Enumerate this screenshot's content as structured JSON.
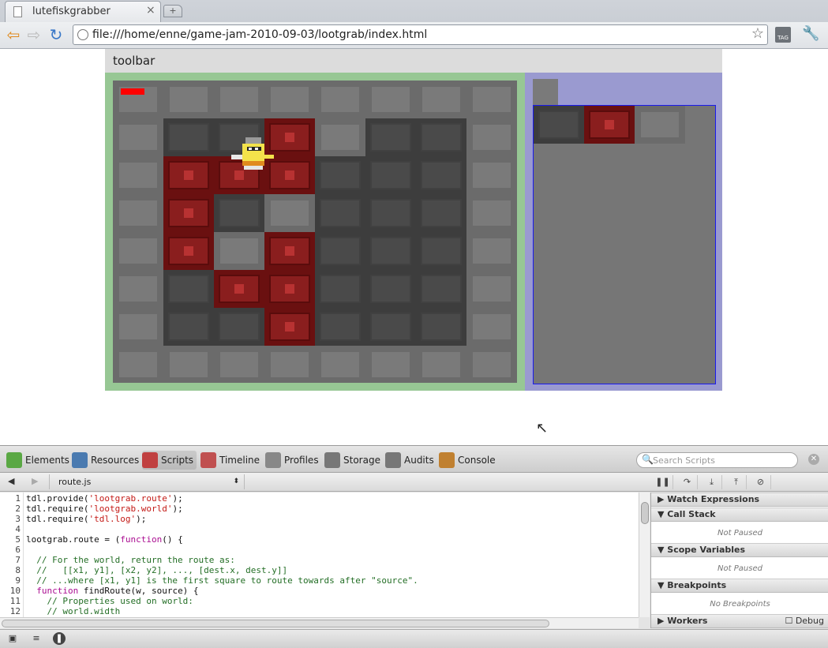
{
  "browser": {
    "tab_title": "lutefiskgrabber",
    "tab_close": "×",
    "new_tab": "+",
    "url": "file:///home/enne/game-jam-2010-09-03/lootgrab/index.html",
    "tag_label": "TAG"
  },
  "page": {
    "toolbar_label": "toolbar"
  },
  "devtools": {
    "tabs": [
      {
        "label": "Elements",
        "icon": "elements-icon",
        "color": "#5aa844"
      },
      {
        "label": "Resources",
        "icon": "resources-icon",
        "color": "#4a7ab0"
      },
      {
        "label": "Scripts",
        "icon": "scripts-icon",
        "color": "#c04040"
      },
      {
        "label": "Timeline",
        "icon": "timeline-icon",
        "color": "#c05050"
      },
      {
        "label": "Profiles",
        "icon": "profiles-icon",
        "color": "#888888"
      },
      {
        "label": "Storage",
        "icon": "storage-icon",
        "color": "#777777"
      },
      {
        "label": "Audits",
        "icon": "audits-icon",
        "color": "#777777"
      },
      {
        "label": "Console",
        "icon": "console-icon",
        "color": "#c08030"
      }
    ],
    "selected_tab": "Scripts",
    "search_placeholder": "Search Scripts",
    "file": "route.js",
    "code_lines": [
      {
        "n": "1",
        "html": "tdl.provide(<span class='str'>'lootgrab.route'</span>);"
      },
      {
        "n": "2",
        "html": "tdl.require(<span class='str'>'lootgrab.world'</span>);"
      },
      {
        "n": "3",
        "html": "tdl.require(<span class='str'>'tdl.log'</span>);"
      },
      {
        "n": "4",
        "html": ""
      },
      {
        "n": "5",
        "html": "lootgrab.route = (<span class='kw'>function</span>() {"
      },
      {
        "n": "6",
        "html": ""
      },
      {
        "n": "7",
        "html": "  <span class='cm'>// For the world, return the route as:</span>"
      },
      {
        "n": "8",
        "html": "  <span class='cm'>//   [[x1, y1], [x2, y2], ..., [dest.x, dest.y]]</span>"
      },
      {
        "n": "9",
        "html": "  <span class='cm'>// ...where [x1, y1] is the first square to route towards after \"source\".</span>"
      },
      {
        "n": "10",
        "html": "  <span class='kw'>function</span> findRoute(w, source) {"
      },
      {
        "n": "11",
        "html": "    <span class='cm'>// Properties used on world:</span>"
      },
      {
        "n": "12",
        "html": "    <span class='cm'>// world.width</span>"
      }
    ],
    "sidebar": {
      "watch": "Watch Expressions",
      "callstack": "Call Stack",
      "callstack_status": "Not Paused",
      "scope": "Scope Variables",
      "scope_status": "Not Paused",
      "breakpoints": "Breakpoints",
      "breakpoints_status": "No Breakpoints",
      "workers": "Workers",
      "debug_label": "Debug"
    }
  },
  "colors": {
    "game_border": "#97c794",
    "side_panel": "#9a9ad0",
    "health": "#ff0000"
  },
  "game": {
    "map": [
      "LLLLLLLL",
      "LDDRLDDL",
      "LRRRDDDL",
      "LRDLDDDL",
      "LRLRDDDL",
      "LDRRDDDL",
      "LDDRDDDL",
      "LLLLLLLL"
    ],
    "inventory": [
      "D",
      "R",
      "L"
    ]
  }
}
